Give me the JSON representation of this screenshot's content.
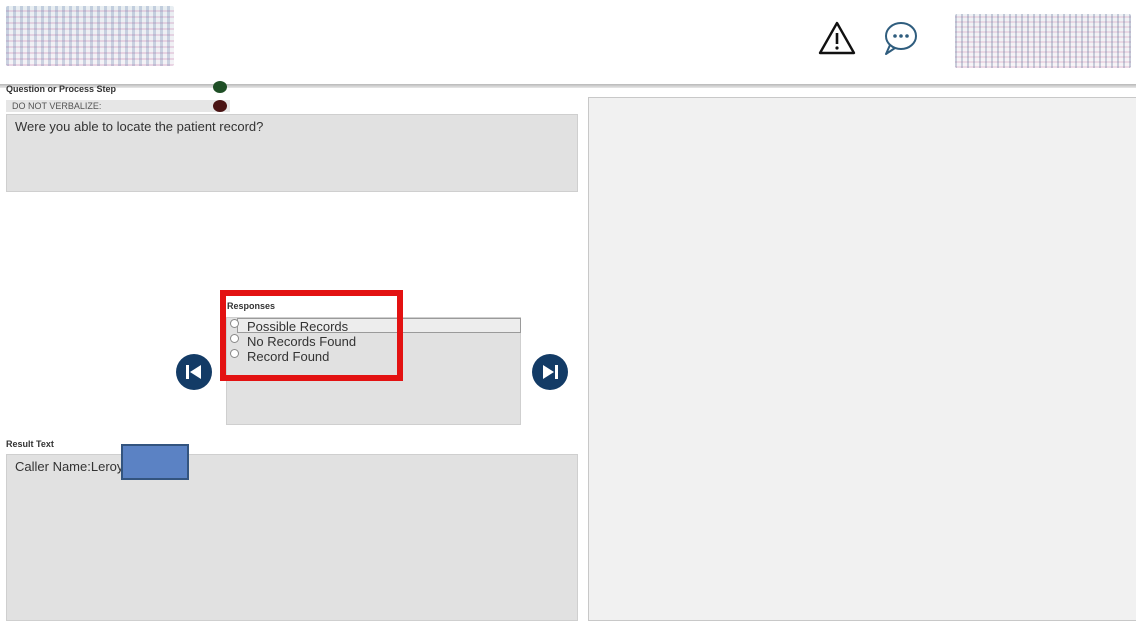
{
  "header": {
    "alert_icon": "warning-triangle-icon",
    "chat_icon": "chat-bubble-icon"
  },
  "question": {
    "section_label": "Question or Process Step",
    "sub_label": "DO NOT VERBALIZE:",
    "text": "Were you able to locate the patient record?",
    "status_colors": [
      "#1f4f26",
      "#4a1414"
    ]
  },
  "responses": {
    "label": "Responses",
    "items": [
      {
        "label": "Possible Records",
        "selected": false
      },
      {
        "label": "No Records Found",
        "selected": false
      },
      {
        "label": "Record Found",
        "selected": false
      }
    ],
    "prev_icon": "skip-back-icon",
    "next_icon": "skip-forward-icon"
  },
  "result": {
    "label": "Result Text",
    "text": "Caller Name:Leroy"
  },
  "colors": {
    "accent": "#133b66",
    "highlight": "#e31212",
    "redaction": "#5b82c4"
  }
}
